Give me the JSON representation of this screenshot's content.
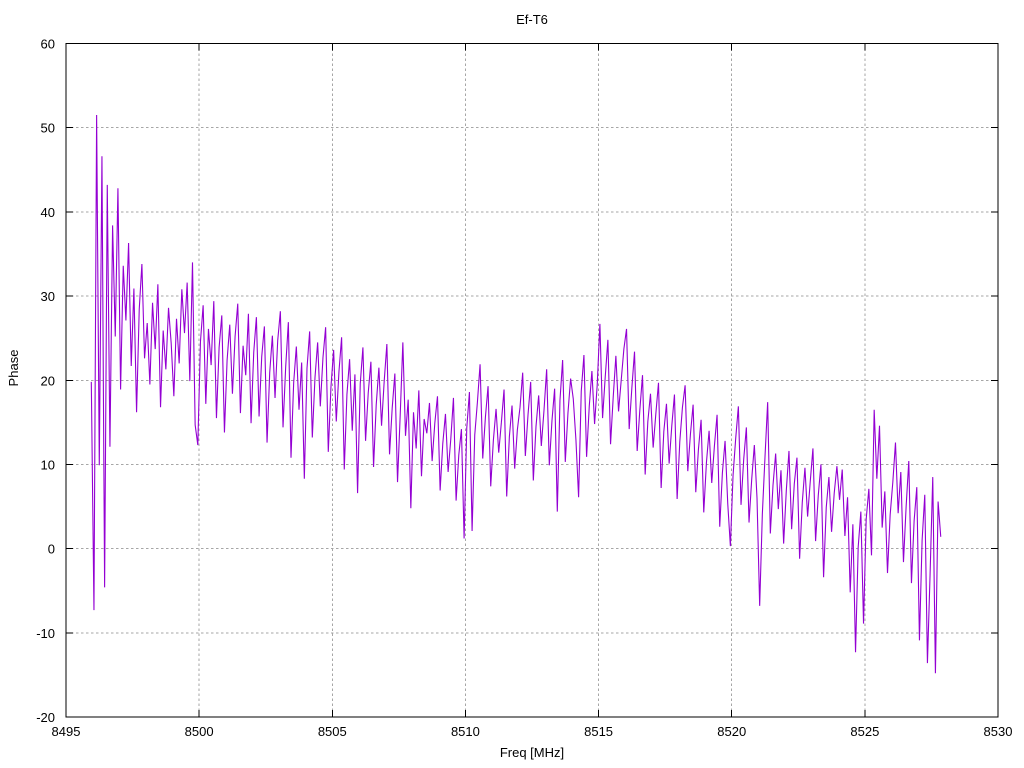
{
  "window": {
    "title": "Ef-T6"
  },
  "chart_data": {
    "type": "line",
    "title": "Ef-T6",
    "xlabel": "Freq [MHz]",
    "ylabel": "Phase",
    "xlim": [
      8495,
      8530
    ],
    "ylim": [
      -20,
      60
    ],
    "xticks": [
      8495,
      8500,
      8505,
      8510,
      8515,
      8520,
      8525,
      8530
    ],
    "yticks": [
      -20,
      -10,
      0,
      10,
      20,
      30,
      40,
      50,
      60
    ],
    "grid": "dashed",
    "legend_position": "none",
    "colors": {
      "line": "#9400d3",
      "grid": "#a6a6a6",
      "axis": "#000000",
      "background": "#ffffff"
    },
    "series": [
      {
        "name": "Phase",
        "color": "#9400d3",
        "x_start": 8495.95,
        "x_step": 0.1,
        "values": [
          19.8,
          -7.3,
          51.5,
          9.9,
          46.6,
          -4.6,
          43.2,
          12.1,
          38.4,
          25.2,
          42.8,
          18.9,
          33.6,
          27.1,
          36.3,
          21.7,
          30.9,
          16.2,
          28.4,
          33.8,
          22.6,
          26.8,
          19.5,
          29.2,
          23.7,
          31.4,
          16.8,
          25.9,
          21.3,
          28.6,
          24.4,
          18.1,
          27.3,
          22.0,
          30.8,
          25.6,
          31.6,
          19.9,
          34.0,
          14.7,
          12.3,
          24.6,
          28.9,
          17.2,
          26.1,
          21.8,
          29.4,
          15.5,
          23.9,
          27.7,
          13.8,
          22.4,
          26.6,
          18.4,
          25.2,
          29.1,
          16.1,
          24.1,
          20.6,
          27.9,
          14.9,
          23.3,
          27.5,
          15.7,
          22.8,
          26.4,
          12.6,
          20.9,
          25.3,
          17.9,
          24.7,
          28.2,
          14.4,
          21.6,
          26.9,
          10.8,
          19.7,
          24.0,
          16.5,
          22.1,
          8.3,
          21.4,
          25.8,
          13.2,
          20.3,
          24.5,
          16.9,
          22.7,
          26.3,
          11.5,
          19.2,
          23.6,
          15.1,
          21.0,
          25.1,
          9.4,
          18.3,
          22.5,
          14.0,
          20.7,
          6.6,
          19.6,
          23.9,
          12.8,
          18.5,
          22.2,
          9.7,
          17.1,
          21.5,
          14.6,
          19.9,
          24.3,
          11.2,
          16.7,
          20.8,
          7.9,
          15.8,
          24.5,
          13.4,
          17.7,
          4.8,
          16.2,
          11.9,
          18.8,
          8.6,
          15.4,
          13.7,
          17.3,
          10.4,
          14.9,
          18.1,
          6.9,
          12.5,
          16.0,
          9.1,
          13.0,
          17.9,
          5.7,
          11.1,
          14.2,
          1.2,
          14.3,
          18.6,
          2.1,
          13.5,
          17.4,
          21.9,
          10.7,
          15.6,
          19.3,
          7.4,
          12.9,
          16.6,
          11.4,
          15.0,
          18.9,
          6.2,
          13.3,
          17.0,
          9.5,
          14.1,
          16.8,
          20.9,
          11.0,
          15.9,
          19.8,
          8.1,
          14.5,
          18.2,
          12.2,
          16.4,
          21.3,
          9.9,
          15.2,
          19.0,
          4.4,
          17.6,
          22.4,
          10.3,
          16.1,
          20.2,
          17.8,
          12.9,
          6.1,
          18.7,
          23.0,
          10.9,
          16.9,
          21.1,
          14.8,
          19.5,
          26.7,
          15.5,
          20.4,
          24.8,
          12.4,
          18.0,
          22.9,
          16.3,
          20.0,
          23.7,
          26.1,
          14.2,
          19.1,
          23.4,
          11.6,
          16.5,
          20.6,
          8.8,
          15.1,
          18.4,
          12.0,
          16.0,
          19.7,
          7.2,
          13.9,
          17.2,
          10.1,
          14.6,
          18.3,
          5.9,
          12.7,
          16.8,
          19.4,
          9.2,
          13.6,
          17.1,
          6.7,
          11.8,
          15.3,
          4.3,
          10.2,
          14.0,
          7.8,
          12.2,
          15.9,
          2.6,
          9.0,
          12.8,
          5.4,
          0.3,
          8.7,
          13.1,
          16.9,
          5.2,
          10.6,
          14.4,
          3.1,
          8.2,
          12.3,
          6.0,
          -6.8,
          4.1,
          10.9,
          17.4,
          1.8,
          7.5,
          11.3,
          4.7,
          9.3,
          0.6,
          6.9,
          11.6,
          2.3,
          7.7,
          10.8,
          -1.2,
          5.5,
          9.6,
          3.8,
          8.0,
          11.9,
          0.9,
          6.3,
          10.0,
          -3.4,
          4.9,
          8.5,
          2.0,
          6.6,
          9.8,
          5.8,
          9.4,
          1.5,
          6.1,
          -5.2,
          2.9,
          -12.3,
          0.2,
          4.4,
          -8.9,
          3.5,
          7.1,
          -0.8,
          16.5,
          8.3,
          14.6,
          2.5,
          6.8,
          -2.9,
          4.0,
          7.9,
          12.6,
          4.2,
          9.1,
          -1.6,
          5.0,
          10.4,
          -4.1,
          3.3,
          7.3,
          -10.9,
          1.0,
          6.4,
          -13.6,
          -3.0,
          8.5,
          -14.8,
          5.6,
          1.4
        ]
      }
    ]
  }
}
